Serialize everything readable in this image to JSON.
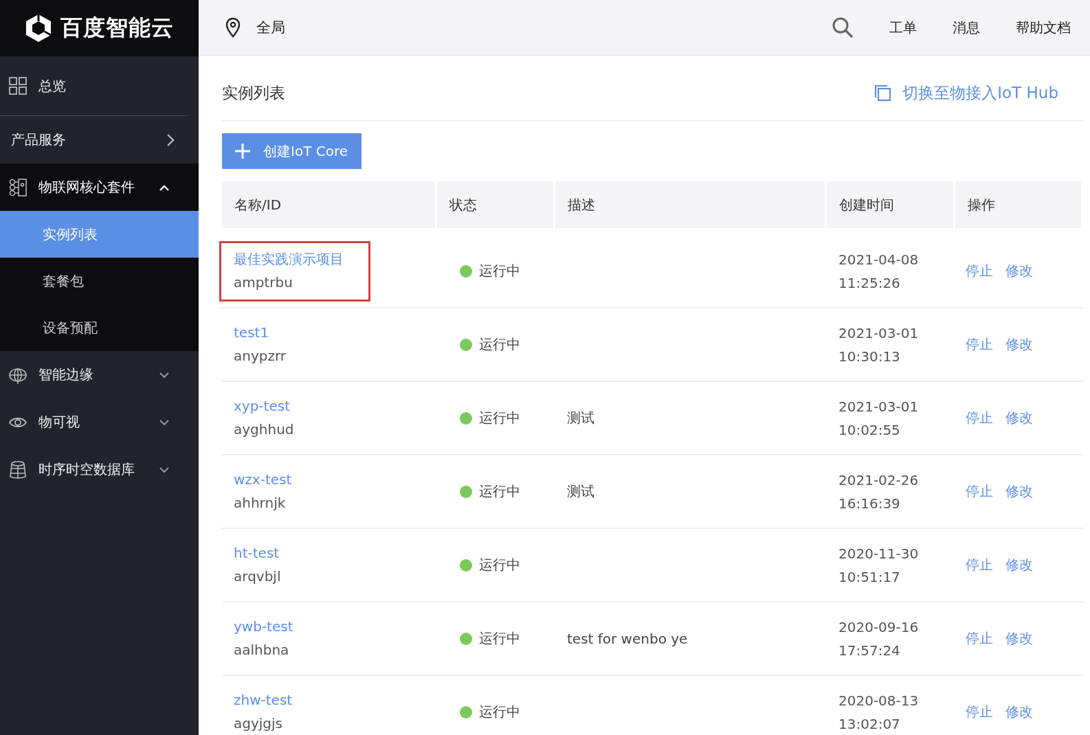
{
  "brand": {
    "name": "百度智能云"
  },
  "sidebar": {
    "items": [
      {
        "label": "总览",
        "kind": "plain"
      },
      {
        "label": "产品服务",
        "kind": "link"
      },
      {
        "label": "物联网核心套件",
        "kind": "group",
        "expanded": true,
        "children": [
          {
            "label": "实例列表",
            "selected": true
          },
          {
            "label": "套餐包",
            "selected": false
          },
          {
            "label": "设备预配",
            "selected": false
          }
        ]
      },
      {
        "label": "智能边缘",
        "kind": "group",
        "expanded": false
      },
      {
        "label": "物可视",
        "kind": "group",
        "expanded": false
      },
      {
        "label": "时序时空数据库",
        "kind": "group",
        "expanded": false
      }
    ]
  },
  "header": {
    "region": "全局",
    "links": [
      "工单",
      "消息",
      "帮助文档"
    ]
  },
  "page": {
    "title": "实例列表",
    "switch_link": "切换至物接入IoT Hub",
    "create_button": "创建IoT Core"
  },
  "table": {
    "columns": [
      "名称/ID",
      "状态",
      "描述",
      "创建时间",
      "操作"
    ],
    "rows": [
      {
        "name": "最佳实践演示项目",
        "id": "amptrbu",
        "status": "运行中",
        "description": "",
        "date": "2021-04-08",
        "time": "11:25:26",
        "actions": [
          "停止",
          "修改"
        ],
        "highlighted": true
      },
      {
        "name": "test1",
        "id": "anypzrr",
        "status": "运行中",
        "description": "",
        "date": "2021-03-01",
        "time": "10:30:13",
        "actions": [
          "停止",
          "修改"
        ],
        "highlighted": false
      },
      {
        "name": "xyp-test",
        "id": "ayghhud",
        "status": "运行中",
        "description": "测试",
        "date": "2021-03-01",
        "time": "10:02:55",
        "actions": [
          "停止",
          "修改"
        ],
        "highlighted": false
      },
      {
        "name": "wzx-test",
        "id": "ahhrnjk",
        "status": "运行中",
        "description": "测试",
        "date": "2021-02-26",
        "time": "16:16:39",
        "actions": [
          "停止",
          "修改"
        ],
        "highlighted": false
      },
      {
        "name": "ht-test",
        "id": "arqvbjl",
        "status": "运行中",
        "description": "",
        "date": "2020-11-30",
        "time": "10:51:17",
        "actions": [
          "停止",
          "修改"
        ],
        "highlighted": false
      },
      {
        "name": "ywb-test",
        "id": "aalhbna",
        "status": "运行中",
        "description": "test for wenbo ye",
        "date": "2020-09-16",
        "time": "17:57:24",
        "actions": [
          "停止",
          "修改"
        ],
        "highlighted": false
      },
      {
        "name": "zhw-test",
        "id": "agyjgjs",
        "status": "运行中",
        "description": "",
        "date": "2020-08-13",
        "time": "13:02:07",
        "actions": [
          "停止",
          "修改"
        ],
        "highlighted": false
      }
    ]
  }
}
